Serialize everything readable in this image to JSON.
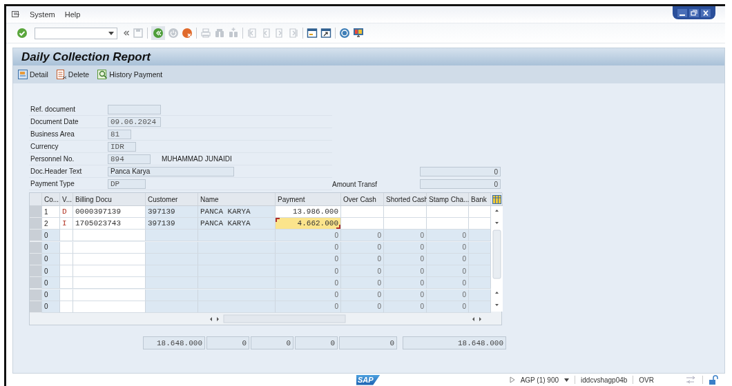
{
  "menu_bar": {
    "items": [
      {
        "label": "System"
      },
      {
        "label": "Help"
      }
    ]
  },
  "toolbar": {
    "buttons": [
      {
        "kind": "enter",
        "disabled": false
      },
      {
        "kind": "command-field"
      },
      {
        "kind": "collapse",
        "disabled": false
      },
      {
        "kind": "save",
        "disabled": true
      },
      {
        "kind": "separator"
      },
      {
        "kind": "back",
        "disabled": false
      },
      {
        "kind": "exit",
        "disabled": true
      },
      {
        "kind": "cancel",
        "disabled": false
      },
      {
        "kind": "separator"
      },
      {
        "kind": "print",
        "disabled": true
      },
      {
        "kind": "find",
        "disabled": true
      },
      {
        "kind": "find-next",
        "disabled": true
      },
      {
        "kind": "separator"
      },
      {
        "kind": "first-page",
        "disabled": true
      },
      {
        "kind": "previous-page",
        "disabled": true
      },
      {
        "kind": "next-page",
        "disabled": true
      },
      {
        "kind": "last-page",
        "disabled": true
      },
      {
        "kind": "separator"
      },
      {
        "kind": "new-session",
        "disabled": false
      },
      {
        "kind": "shortcut",
        "disabled": false
      },
      {
        "kind": "separator"
      },
      {
        "kind": "help",
        "disabled": false
      },
      {
        "kind": "customize",
        "disabled": false
      }
    ]
  },
  "window": {
    "title": "Daily Collection Report"
  },
  "app_toolbar": [
    {
      "kind": "detail",
      "label": "Detail"
    },
    {
      "kind": "delete",
      "label": "Delete"
    },
    {
      "kind": "history",
      "label": "History Payment"
    }
  ],
  "form": {
    "fields": [
      {
        "label": "Ref. document"
      },
      {
        "label": "Document Date",
        "value": "09.06.2024"
      },
      {
        "label": "Business Area",
        "value": "81"
      },
      {
        "label": "Currency",
        "value": "IDR"
      },
      {
        "label": "Personnel No.",
        "value": "894",
        "description": "MUHAMMAD JUNAIDI"
      },
      {
        "label": "Doc.Header Text",
        "value": "Panca Karya",
        "side": {
          "value": "0"
        }
      },
      {
        "label": "Payment Type",
        "value": "DP",
        "side": {
          "label": "Amount Transf",
          "value": "0"
        }
      }
    ]
  },
  "table": {
    "columns": [
      {
        "label": "Co...",
        "kind": "counter"
      },
      {
        "label": "V...",
        "kind": "indicator"
      },
      {
        "label": "Billing Docu",
        "kind": "input"
      },
      {
        "label": "Customer",
        "kind": "display"
      },
      {
        "label": "Name",
        "kind": "display"
      },
      {
        "label": "Payment",
        "kind": "amount"
      },
      {
        "label": "Over Cash",
        "kind": "amount"
      },
      {
        "label": "Shorted Cash",
        "kind": "amount"
      },
      {
        "label": "Stamp Cha...",
        "kind": "amount"
      },
      {
        "label": "Bank",
        "kind": "amount"
      }
    ],
    "rows": [
      {
        "entered": true,
        "cells": [
          "1",
          "D",
          "0000397139",
          "397139",
          "PANCA KARYA",
          "13.986.000",
          "",
          "",
          "",
          ""
        ]
      },
      {
        "entered": true,
        "cells": [
          "2",
          "I",
          "1705023743",
          "397139",
          "PANCA KARYA",
          {
            "text": "4.662.000",
            "focused": true
          },
          "",
          "",
          "",
          ""
        ]
      },
      {
        "entered": false,
        "cells": [
          "0",
          "",
          "",
          "",
          "",
          "0",
          "0",
          "0",
          "0",
          ""
        ]
      },
      {
        "entered": false,
        "cells": [
          "0",
          "",
          "",
          "",
          "",
          "0",
          "0",
          "0",
          "0",
          ""
        ]
      },
      {
        "entered": false,
        "cells": [
          "0",
          "",
          "",
          "",
          "",
          "0",
          "0",
          "0",
          "0",
          ""
        ]
      },
      {
        "entered": false,
        "cells": [
          "0",
          "",
          "",
          "",
          "",
          "0",
          "0",
          "0",
          "0",
          ""
        ]
      },
      {
        "entered": false,
        "cells": [
          "0",
          "",
          "",
          "",
          "",
          "0",
          "0",
          "0",
          "0",
          ""
        ]
      },
      {
        "entered": false,
        "cells": [
          "0",
          "",
          "",
          "",
          "",
          "0",
          "0",
          "0",
          "0",
          ""
        ]
      },
      {
        "entered": false,
        "cells": [
          "0",
          "",
          "",
          "",
          "",
          "0",
          "0",
          "0",
          "0",
          ""
        ]
      }
    ]
  },
  "totals": [
    "18.648.000",
    "0",
    "0",
    "0",
    "0",
    "18.648.000"
  ],
  "status_bar": {
    "logo": "SAP",
    "system": "AGP (1) 900",
    "server": "iddcvshagp04b",
    "mode": "OVR"
  }
}
